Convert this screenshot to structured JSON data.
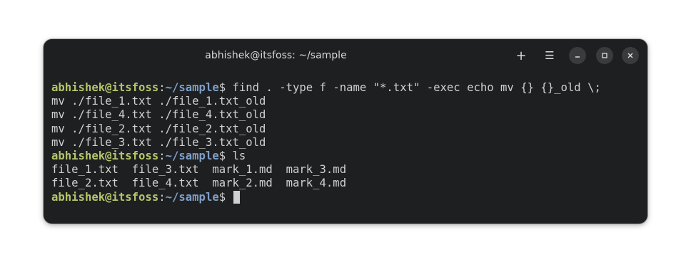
{
  "window": {
    "title": "abhishek@itsfoss: ~/sample"
  },
  "titlebar_buttons": {
    "new_tab_icon": "plus-icon",
    "menu_icon": "hamburger-menu-icon",
    "minimize_icon": "minimize-icon",
    "maximize_icon": "maximize-icon",
    "close_icon": "close-icon",
    "new_tab_glyph": "+",
    "menu_glyph": "☰"
  },
  "terminal": {
    "prompt_user": "abhishek@itsfoss",
    "prompt_colon": ":",
    "prompt_path": "~/sample",
    "prompt_symbol": "$",
    "lines": [
      {
        "type": "command",
        "command": " find . -type f -name \"*.txt\" -exec echo mv {} {}_old \\;"
      },
      {
        "type": "output",
        "text": "mv ./file_1.txt ./file_1.txt_old"
      },
      {
        "type": "output",
        "text": "mv ./file_4.txt ./file_4.txt_old"
      },
      {
        "type": "output",
        "text": "mv ./file_2.txt ./file_2.txt_old"
      },
      {
        "type": "output",
        "text": "mv ./file_3.txt ./file_3.txt_old"
      },
      {
        "type": "command",
        "command": " ls"
      },
      {
        "type": "output",
        "text": "file_1.txt  file_3.txt  mark_1.md  mark_3.md"
      },
      {
        "type": "output",
        "text": "file_2.txt  file_4.txt  mark_2.md  mark_4.md"
      },
      {
        "type": "command",
        "command": " "
      }
    ]
  },
  "colors": {
    "background": "#1e1f21",
    "user": "#b4c66b",
    "path": "#7f9fc8",
    "text": "#d0d0d0"
  }
}
